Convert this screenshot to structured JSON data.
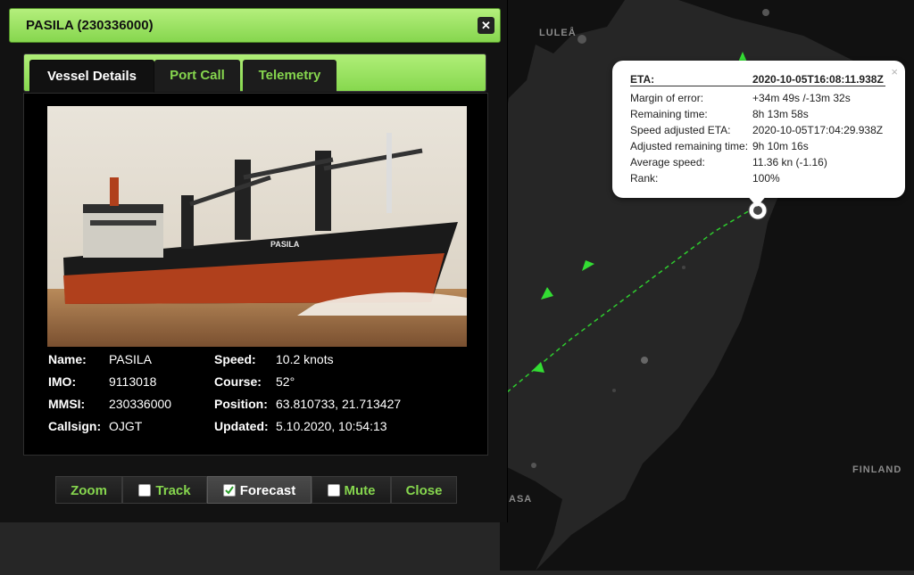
{
  "map": {
    "labels": {
      "lulea": "LULEÅ",
      "finland": "FINLAND",
      "vaasa_partial": "ASA"
    },
    "colors": {
      "sea": "#262626",
      "land": "#111111",
      "route": "#2ecc2e",
      "ship": "#33dd33"
    }
  },
  "panel": {
    "title": "PASILA (230336000)",
    "close_icon": "close-icon",
    "tabs": [
      {
        "label": "Vessel Details",
        "active": true
      },
      {
        "label": "Port Call",
        "active": false
      },
      {
        "label": "Telemetry",
        "active": false
      }
    ],
    "photo": {
      "hull_name": "PASILA"
    },
    "fields": {
      "name": {
        "label": "Name:",
        "value": "PASILA"
      },
      "imo": {
        "label": "IMO:",
        "value": "9113018"
      },
      "mmsi": {
        "label": "MMSI:",
        "value": "230336000"
      },
      "callsign": {
        "label": "Callsign:",
        "value": "OJGT"
      },
      "speed": {
        "label": "Speed:",
        "value": "10.2 knots"
      },
      "course": {
        "label": "Course:",
        "value": "52°"
      },
      "position": {
        "label": "Position:",
        "value": "63.810733, 21.713427"
      },
      "updated": {
        "label": "Updated:",
        "value": "5.10.2020, 10:54:13"
      }
    },
    "buttons": [
      {
        "label": "Zoom",
        "checkbox": false
      },
      {
        "label": "Track",
        "checkbox": true,
        "checked": false
      },
      {
        "label": "Forecast",
        "checkbox": true,
        "checked": true
      },
      {
        "label": "Mute",
        "checkbox": true,
        "checked": false
      },
      {
        "label": "Close",
        "checkbox": false
      }
    ],
    "accent": "#86d64e"
  },
  "eta_popup": {
    "close_icon": "×",
    "rows": [
      {
        "key": "ETA:",
        "value": "2020-10-05T16:08:11.938Z"
      },
      {
        "key": "Margin of error:",
        "value": "+34m 49s /-13m 32s"
      },
      {
        "key": "Remaining time:",
        "value": "8h 13m 58s"
      },
      {
        "key": "Speed adjusted ETA:",
        "value": "2020-10-05T17:04:29.938Z"
      },
      {
        "key": "Adjusted remaining time:",
        "value": "9h 10m 16s"
      },
      {
        "key": "Average speed:",
        "value": "11.36 kn (-1.16)"
      },
      {
        "key": "Rank:",
        "value": "100%"
      }
    ]
  }
}
